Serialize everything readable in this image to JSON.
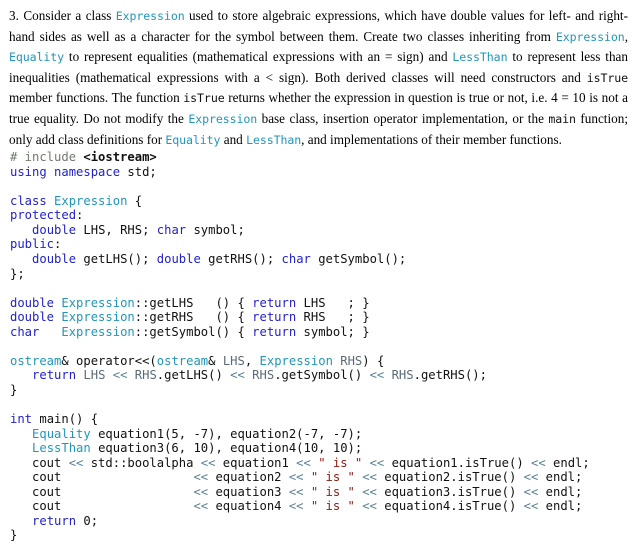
{
  "document": {
    "title": "C++ Expression Class Exercise",
    "question_number": "3.",
    "prompt": {
      "segments": [
        {
          "type": "text",
          "value": "3. Consider a class "
        },
        {
          "type": "code-teal",
          "value": "Expression"
        },
        {
          "type": "text",
          "value": " used to store algebraic expressions, which have double values for left- and right-hand sides as well as a character for the symbol between them. Create two classes inheriting from "
        },
        {
          "type": "code-teal",
          "value": "Expression"
        },
        {
          "type": "text",
          "value": ", "
        },
        {
          "type": "code-teal",
          "value": "Equality"
        },
        {
          "type": "text",
          "value": " to represent equalities (mathematical expressions with an = sign) and "
        },
        {
          "type": "code-teal",
          "value": "LessThan"
        },
        {
          "type": "text",
          "value": " to represent less than inequalities (mathematical expressions with a < sign). Both derived classes will need constructors and "
        },
        {
          "type": "code-black",
          "value": "isTrue"
        },
        {
          "type": "text",
          "value": " member functions. The function "
        },
        {
          "type": "code-black",
          "value": "isTrue"
        },
        {
          "type": "text",
          "value": " returns whether the expression in question is true or not, i.e. 4 = 10 is not a true equality. Do not modify the "
        },
        {
          "type": "code-teal",
          "value": "Expression"
        },
        {
          "type": "text",
          "value": " base class, insertion operator implementation, or the "
        },
        {
          "type": "code-black",
          "value": "main"
        },
        {
          "type": "text",
          "value": " function; only add class definitions for "
        },
        {
          "type": "code-teal",
          "value": "Equality"
        },
        {
          "type": "text",
          "value": " and "
        },
        {
          "type": "code-teal",
          "value": "LessThan"
        },
        {
          "type": "text",
          "value": ", and implementations of their member functions."
        }
      ]
    },
    "code": {
      "language": "cpp",
      "lines": [
        {
          "tokens": [
            {
              "c": "pre",
              "t": "# include "
            },
            {
              "c": "hdr",
              "t": "<iostream>"
            }
          ]
        },
        {
          "tokens": [
            {
              "c": "kw",
              "t": "using namespace "
            },
            {
              "c": "plain",
              "t": "std;"
            }
          ]
        },
        {
          "tokens": []
        },
        {
          "tokens": [
            {
              "c": "kw",
              "t": "class "
            },
            {
              "c": "type",
              "t": "Expression"
            },
            {
              "c": "plain",
              "t": " {"
            }
          ]
        },
        {
          "tokens": [
            {
              "c": "kw",
              "t": "protected"
            },
            {
              "c": "plain",
              "t": ":"
            }
          ]
        },
        {
          "tokens": [
            {
              "c": "plain",
              "t": "   "
            },
            {
              "c": "kw",
              "t": "double "
            },
            {
              "c": "plain",
              "t": "LHS, RHS; "
            },
            {
              "c": "kw",
              "t": "char "
            },
            {
              "c": "plain",
              "t": "symbol;"
            }
          ]
        },
        {
          "tokens": [
            {
              "c": "kw",
              "t": "public"
            },
            {
              "c": "plain",
              "t": ":"
            }
          ]
        },
        {
          "tokens": [
            {
              "c": "plain",
              "t": "   "
            },
            {
              "c": "kw",
              "t": "double "
            },
            {
              "c": "plain",
              "t": "getLHS(); "
            },
            {
              "c": "kw",
              "t": "double "
            },
            {
              "c": "plain",
              "t": "getRHS(); "
            },
            {
              "c": "kw",
              "t": "char "
            },
            {
              "c": "plain",
              "t": "getSymbol();"
            }
          ]
        },
        {
          "tokens": [
            {
              "c": "plain",
              "t": "};"
            }
          ]
        },
        {
          "tokens": []
        },
        {
          "tokens": [
            {
              "c": "kw",
              "t": "double "
            },
            {
              "c": "type",
              "t": "Expression"
            },
            {
              "c": "plain",
              "t": "::getLHS   () { "
            },
            {
              "c": "kw",
              "t": "return "
            },
            {
              "c": "plain",
              "t": "LHS   ; }"
            }
          ]
        },
        {
          "tokens": [
            {
              "c": "kw",
              "t": "double "
            },
            {
              "c": "type",
              "t": "Expression"
            },
            {
              "c": "plain",
              "t": "::getRHS   () { "
            },
            {
              "c": "kw",
              "t": "return "
            },
            {
              "c": "plain",
              "t": "RHS   ; }"
            }
          ]
        },
        {
          "tokens": [
            {
              "c": "kw",
              "t": "char   "
            },
            {
              "c": "type",
              "t": "Expression"
            },
            {
              "c": "plain",
              "t": "::getSymbol() { "
            },
            {
              "c": "kw",
              "t": "return "
            },
            {
              "c": "plain",
              "t": "symbol; }"
            }
          ]
        },
        {
          "tokens": []
        },
        {
          "tokens": [
            {
              "c": "type",
              "t": "ostream"
            },
            {
              "c": "plain",
              "t": "& operator<<("
            },
            {
              "c": "type",
              "t": "ostream"
            },
            {
              "c": "plain",
              "t": "& "
            },
            {
              "c": "dim",
              "t": "LHS"
            },
            {
              "c": "plain",
              "t": ", "
            },
            {
              "c": "type",
              "t": "Expression "
            },
            {
              "c": "dim",
              "t": "RHS"
            },
            {
              "c": "plain",
              "t": ") {"
            }
          ]
        },
        {
          "tokens": [
            {
              "c": "plain",
              "t": "   "
            },
            {
              "c": "kw",
              "t": "return "
            },
            {
              "c": "dim",
              "t": "LHS "
            },
            {
              "c": "op",
              "t": "<< "
            },
            {
              "c": "dim",
              "t": "RHS"
            },
            {
              "c": "plain",
              "t": ".getLHS() "
            },
            {
              "c": "op",
              "t": "<< "
            },
            {
              "c": "dim",
              "t": "RHS"
            },
            {
              "c": "plain",
              "t": ".getSymbol() "
            },
            {
              "c": "op",
              "t": "<< "
            },
            {
              "c": "dim",
              "t": "RHS"
            },
            {
              "c": "plain",
              "t": ".getRHS();"
            }
          ]
        },
        {
          "tokens": [
            {
              "c": "plain",
              "t": "}"
            }
          ]
        },
        {
          "tokens": []
        },
        {
          "tokens": [
            {
              "c": "kw",
              "t": "int "
            },
            {
              "c": "plain",
              "t": "main() {"
            }
          ]
        },
        {
          "tokens": [
            {
              "c": "plain",
              "t": "   "
            },
            {
              "c": "type",
              "t": "Equality "
            },
            {
              "c": "plain",
              "t": "equation1(5, -7), equation2(-7, -7);"
            }
          ]
        },
        {
          "tokens": [
            {
              "c": "plain",
              "t": "   "
            },
            {
              "c": "type",
              "t": "LessThan "
            },
            {
              "c": "plain",
              "t": "equation3(6, 10), equation4(10, 10);"
            }
          ]
        },
        {
          "tokens": [
            {
              "c": "plain",
              "t": "   cout "
            },
            {
              "c": "op",
              "t": "<< "
            },
            {
              "c": "plain",
              "t": "std::boolalpha "
            },
            {
              "c": "op",
              "t": "<< "
            },
            {
              "c": "plain",
              "t": "equation1 "
            },
            {
              "c": "op",
              "t": "<< "
            },
            {
              "c": "str",
              "t": "\" is \" "
            },
            {
              "c": "op",
              "t": "<< "
            },
            {
              "c": "plain",
              "t": "equation1.isTrue() "
            },
            {
              "c": "op",
              "t": "<< "
            },
            {
              "c": "plain",
              "t": "endl;"
            }
          ]
        },
        {
          "tokens": [
            {
              "c": "plain",
              "t": "   cout                  "
            },
            {
              "c": "op",
              "t": "<< "
            },
            {
              "c": "plain",
              "t": "equation2 "
            },
            {
              "c": "op",
              "t": "<< "
            },
            {
              "c": "str",
              "t": "\" is \" "
            },
            {
              "c": "op",
              "t": "<< "
            },
            {
              "c": "plain",
              "t": "equation2.isTrue() "
            },
            {
              "c": "op",
              "t": "<< "
            },
            {
              "c": "plain",
              "t": "endl;"
            }
          ]
        },
        {
          "tokens": [
            {
              "c": "plain",
              "t": "   cout                  "
            },
            {
              "c": "op",
              "t": "<< "
            },
            {
              "c": "plain",
              "t": "equation3 "
            },
            {
              "c": "op",
              "t": "<< "
            },
            {
              "c": "str",
              "t": "\" is \" "
            },
            {
              "c": "op",
              "t": "<< "
            },
            {
              "c": "plain",
              "t": "equation3.isTrue() "
            },
            {
              "c": "op",
              "t": "<< "
            },
            {
              "c": "plain",
              "t": "endl;"
            }
          ]
        },
        {
          "tokens": [
            {
              "c": "plain",
              "t": "   cout                  "
            },
            {
              "c": "op",
              "t": "<< "
            },
            {
              "c": "plain",
              "t": "equation4 "
            },
            {
              "c": "op",
              "t": "<< "
            },
            {
              "c": "str",
              "t": "\" is \" "
            },
            {
              "c": "op",
              "t": "<< "
            },
            {
              "c": "plain",
              "t": "equation4.isTrue() "
            },
            {
              "c": "op",
              "t": "<< "
            },
            {
              "c": "plain",
              "t": "endl;"
            }
          ]
        },
        {
          "tokens": [
            {
              "c": "plain",
              "t": "   "
            },
            {
              "c": "kw",
              "t": "return "
            },
            {
              "c": "plain",
              "t": "0;"
            }
          ]
        },
        {
          "tokens": [
            {
              "c": "plain",
              "t": "}"
            }
          ]
        }
      ]
    },
    "colors": {
      "background": "#ffffff",
      "body_text": "#000000",
      "keyword_blue": "#2222cc",
      "type_teal": "#2196bd",
      "string_red": "#8b1a12",
      "operator_steel": "#5a7f95",
      "dim_identifier": "#5b6b78",
      "preprocessor_gray": "#707a6e"
    }
  }
}
